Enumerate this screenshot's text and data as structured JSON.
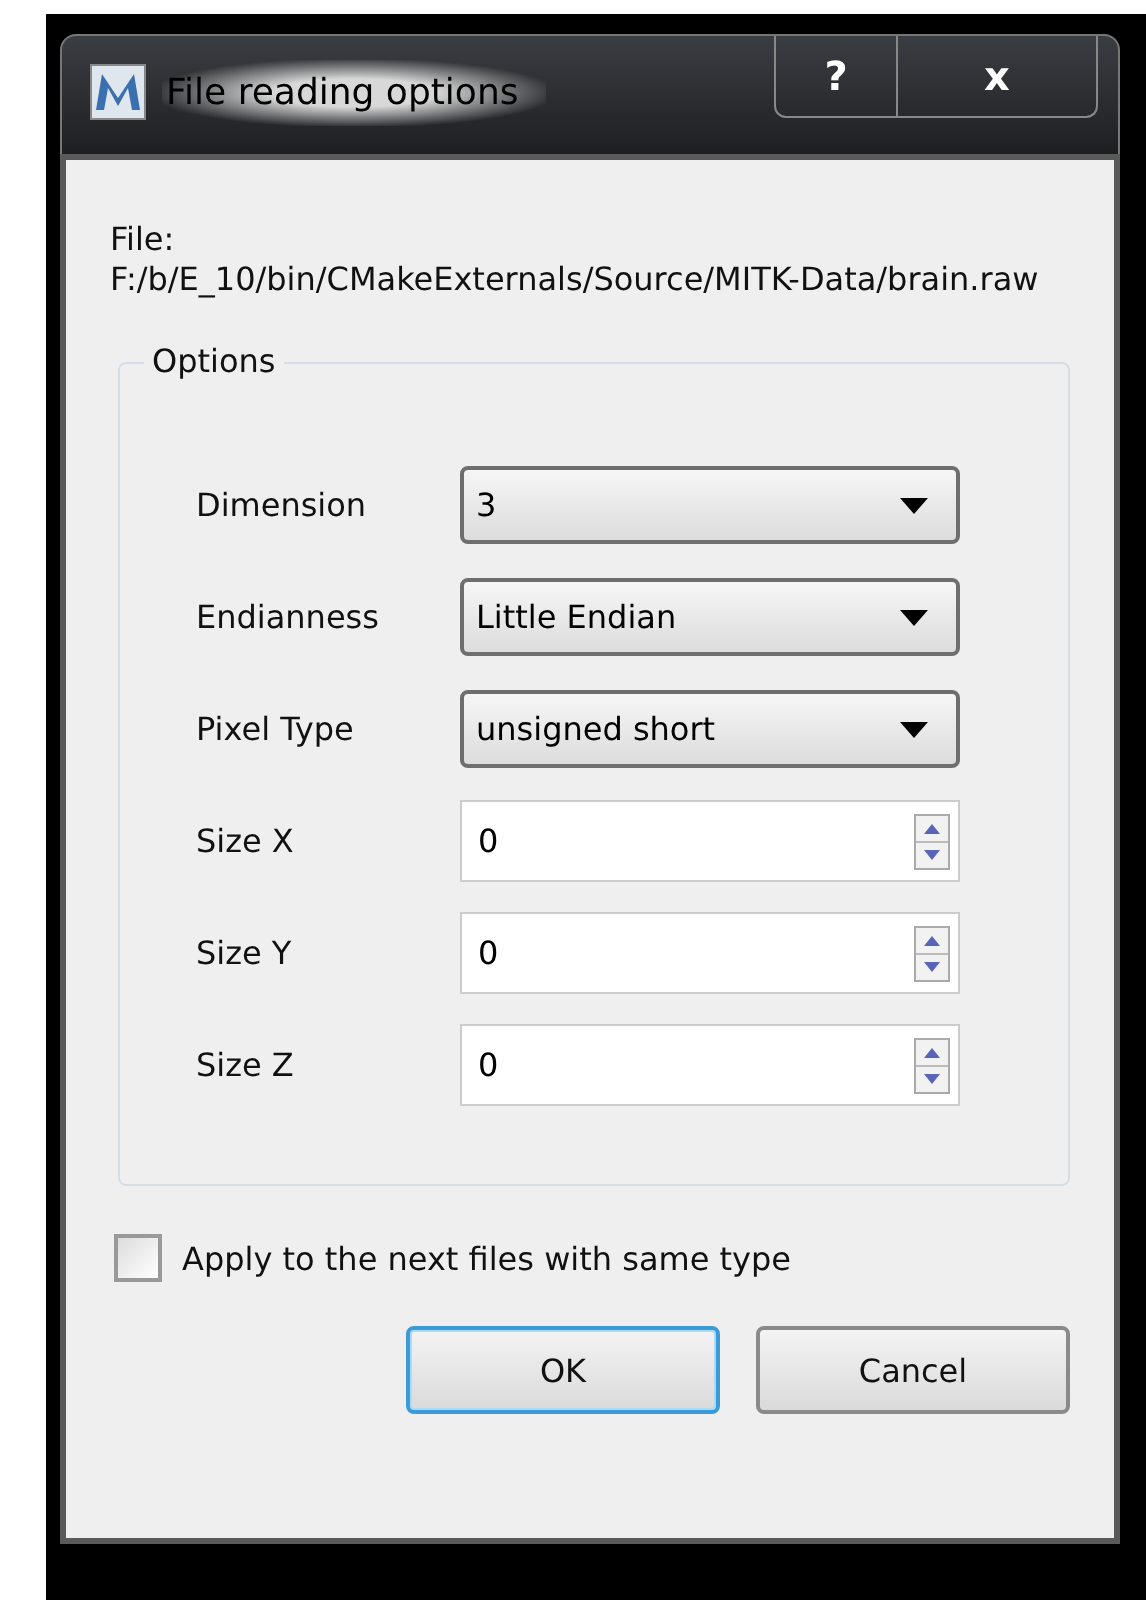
{
  "window": {
    "title": "File reading options",
    "help_button": "?",
    "close_button": "x"
  },
  "file": {
    "label": "File:",
    "path": "F:/b/E_10/bin/CMakeExternals/Source/MITK-Data/brain.raw"
  },
  "options": {
    "title": "Options",
    "fields": [
      {
        "kind": "combo",
        "label": "Dimension",
        "value": "3"
      },
      {
        "kind": "combo",
        "label": "Endianness",
        "value": "Little Endian"
      },
      {
        "kind": "combo",
        "label": "Pixel Type",
        "value": "unsigned short"
      },
      {
        "kind": "spin",
        "label": "Size X",
        "value": "0"
      },
      {
        "kind": "spin",
        "label": "Size Y",
        "value": "0"
      },
      {
        "kind": "spin",
        "label": "Size Z",
        "value": "0"
      }
    ]
  },
  "apply_checkbox": {
    "label": "Apply to the next files with same type",
    "checked": false
  },
  "buttons": [
    {
      "label": "OK",
      "default": true
    },
    {
      "label": "Cancel",
      "default": false
    }
  ]
}
